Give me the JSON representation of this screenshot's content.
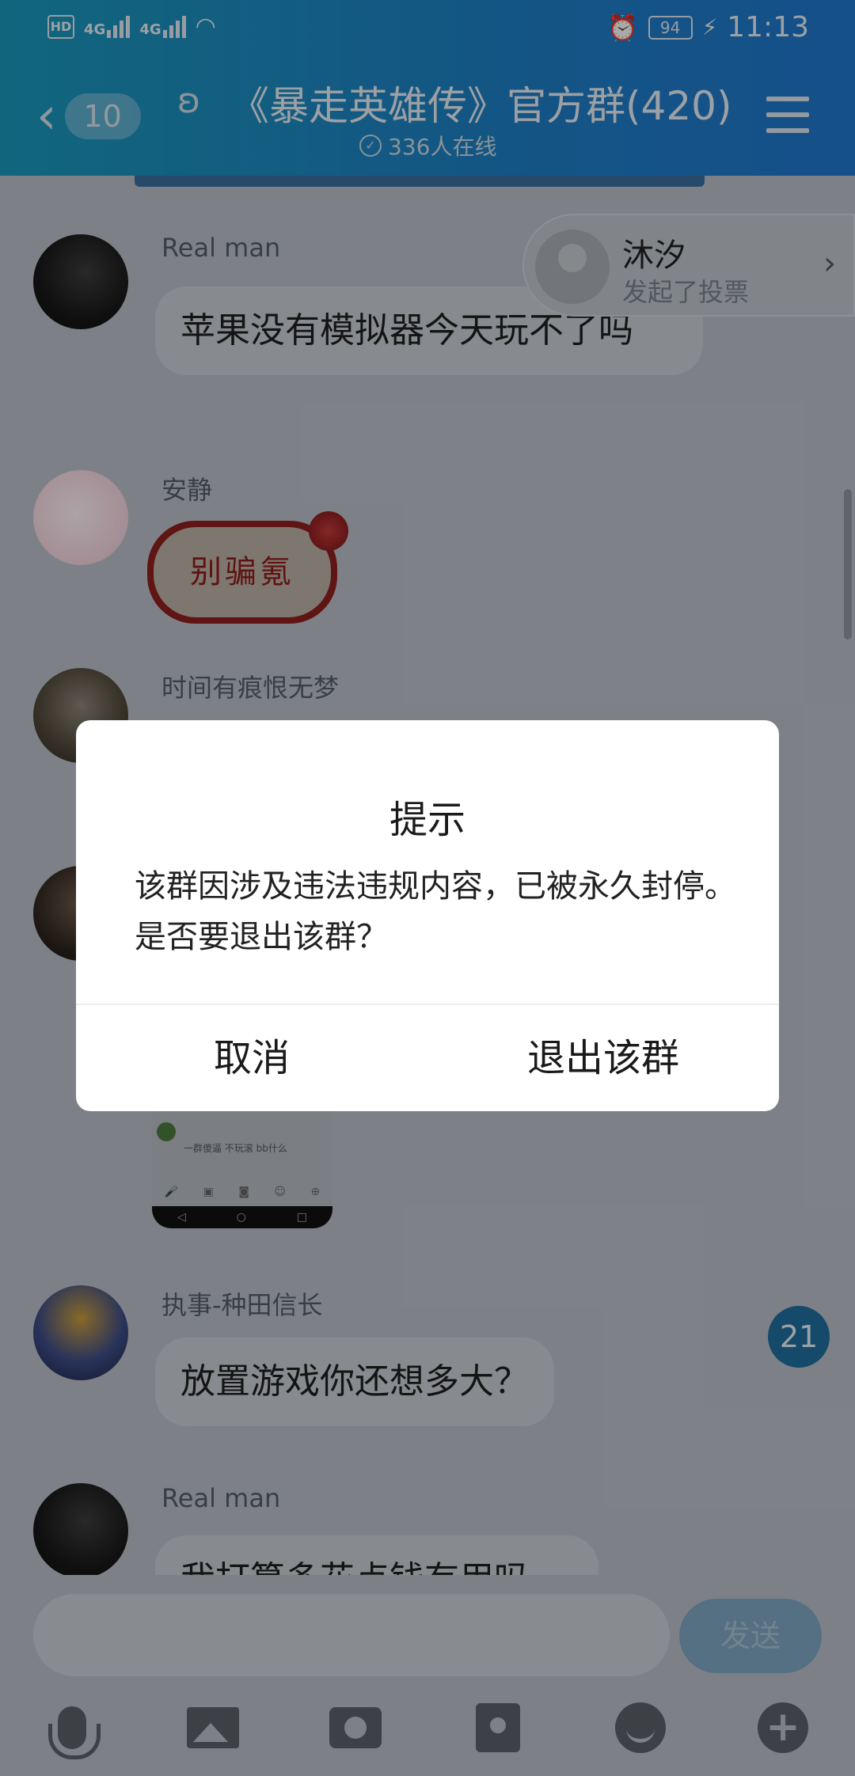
{
  "status_bar": {
    "hd_label": "HD",
    "net1": "4G",
    "net2": "4G",
    "battery": "94",
    "time": "11:13"
  },
  "header": {
    "unread_count": "10",
    "title": "《暴走英雄传》官方群(420)",
    "online_text": "336人在线"
  },
  "vote_card": {
    "name": "沐汐",
    "description": "发起了投票"
  },
  "messages": [
    {
      "sender": "Real man",
      "text": "苹果没有模拟器今天玩不了吗"
    },
    {
      "sender": "安静",
      "sticker_text": "别骗氪"
    },
    {
      "sender": "时间有痕恨无梦"
    },
    {
      "sender": "执事-种田信长",
      "text": "放置游戏你还想多大？"
    },
    {
      "sender": "Real man",
      "text": "我打算多花点钱有用吗"
    }
  ],
  "thumb": {
    "msg": "一群傻逼 不玩滚 bb什么"
  },
  "unread_badge": "21",
  "input": {
    "placeholder": "",
    "send_label": "发送"
  },
  "dialog": {
    "title": "提示",
    "message": "该群因涉及违法违规内容，已被永久封停。是否要退出该群？",
    "cancel_label": "取消",
    "confirm_label": "退出该群"
  },
  "colors": {
    "header_start": "#1a97b9",
    "header_end": "#1f76cc",
    "badge": "#1f6e9c"
  }
}
